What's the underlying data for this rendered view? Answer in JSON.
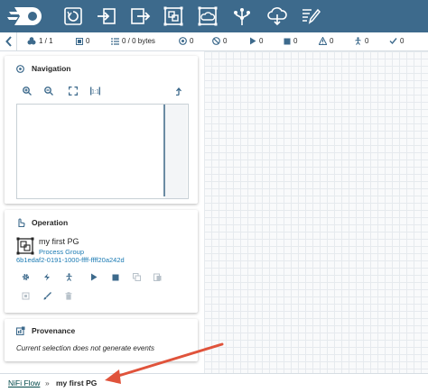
{
  "toolbar": {
    "logo": "nifi-logo",
    "buttons": [
      "processor-icon",
      "input-port-icon",
      "output-port-icon",
      "process-group-icon",
      "remote-process-group-icon",
      "funnel-icon",
      "template-icon",
      "label-icon"
    ]
  },
  "status": {
    "process_groups": "1 / 1",
    "queued_count": "0",
    "queued_size": "0 / 0 bytes",
    "transmitting": "0",
    "not_transmitting": "0",
    "running": "0",
    "stopped": "0",
    "invalid": "0",
    "disabled": "0",
    "up_to_date": "0"
  },
  "navigation": {
    "title": "Navigation"
  },
  "operation": {
    "title": "Operation",
    "component_name": "my first PG",
    "component_type": "Process Group",
    "component_id": "6b1edaf2-0191-1000-ffff-ffff20a242d"
  },
  "provenance": {
    "title": "Provenance",
    "message": "Current selection does not generate events"
  },
  "breadcrumb": {
    "root": "NiFi Flow",
    "separator": "»",
    "current": "my first PG"
  },
  "colors": {
    "toolbar": "#3d6a8c",
    "accent": "#004849",
    "arrow": "#e0533b",
    "link_blue": "#1a7ab3"
  }
}
